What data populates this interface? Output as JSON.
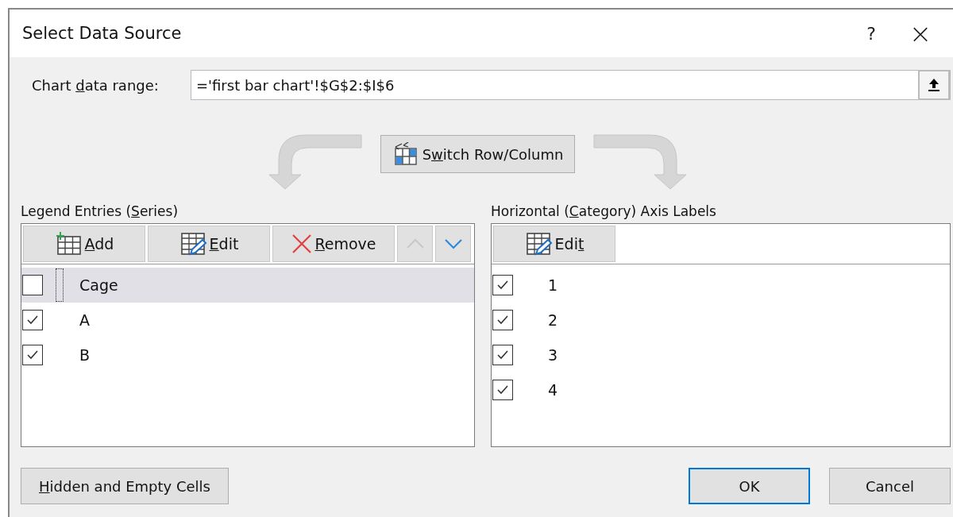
{
  "window": {
    "title": "Select Data Source",
    "help": "?",
    "close": "×"
  },
  "range": {
    "label": {
      "pre": "Chart ",
      "key": "d",
      "post": "ata range:"
    },
    "value": "='first bar chart'!$G$2:$I$6"
  },
  "switch_button": {
    "pre": "S",
    "key": "w",
    "post": "itch Row/Column"
  },
  "legend": {
    "heading": {
      "pre": "Legend Entries (",
      "key": "S",
      "post": "eries)"
    },
    "buttons": [
      {
        "kind": "add",
        "key": "A",
        "post": "dd"
      },
      {
        "kind": "edit",
        "key": "E",
        "post": "dit"
      },
      {
        "kind": "remove",
        "key": "R",
        "post": "emove"
      },
      {
        "kind": "up",
        "disabled": true
      },
      {
        "kind": "down",
        "disabled": false
      }
    ],
    "items": [
      {
        "label": "Cage",
        "checked": false,
        "selected": true
      },
      {
        "label": "A",
        "checked": true,
        "selected": false
      },
      {
        "label": "B",
        "checked": true,
        "selected": false
      }
    ]
  },
  "axis": {
    "heading": {
      "pre": "Horizontal (",
      "key": "C",
      "post": "ategory) Axis Labels"
    },
    "edit_button": {
      "pre": "Edi",
      "key": "t"
    },
    "items": [
      {
        "label": "1",
        "checked": true
      },
      {
        "label": "2",
        "checked": true
      },
      {
        "label": "3",
        "checked": true
      },
      {
        "label": "4",
        "checked": true
      }
    ]
  },
  "footer": {
    "hidden_button": {
      "key": "H",
      "post": "idden and Empty Cells"
    },
    "buttons": [
      {
        "label": "OK",
        "default": true
      },
      {
        "label": "Cancel",
        "default": false
      }
    ]
  }
}
